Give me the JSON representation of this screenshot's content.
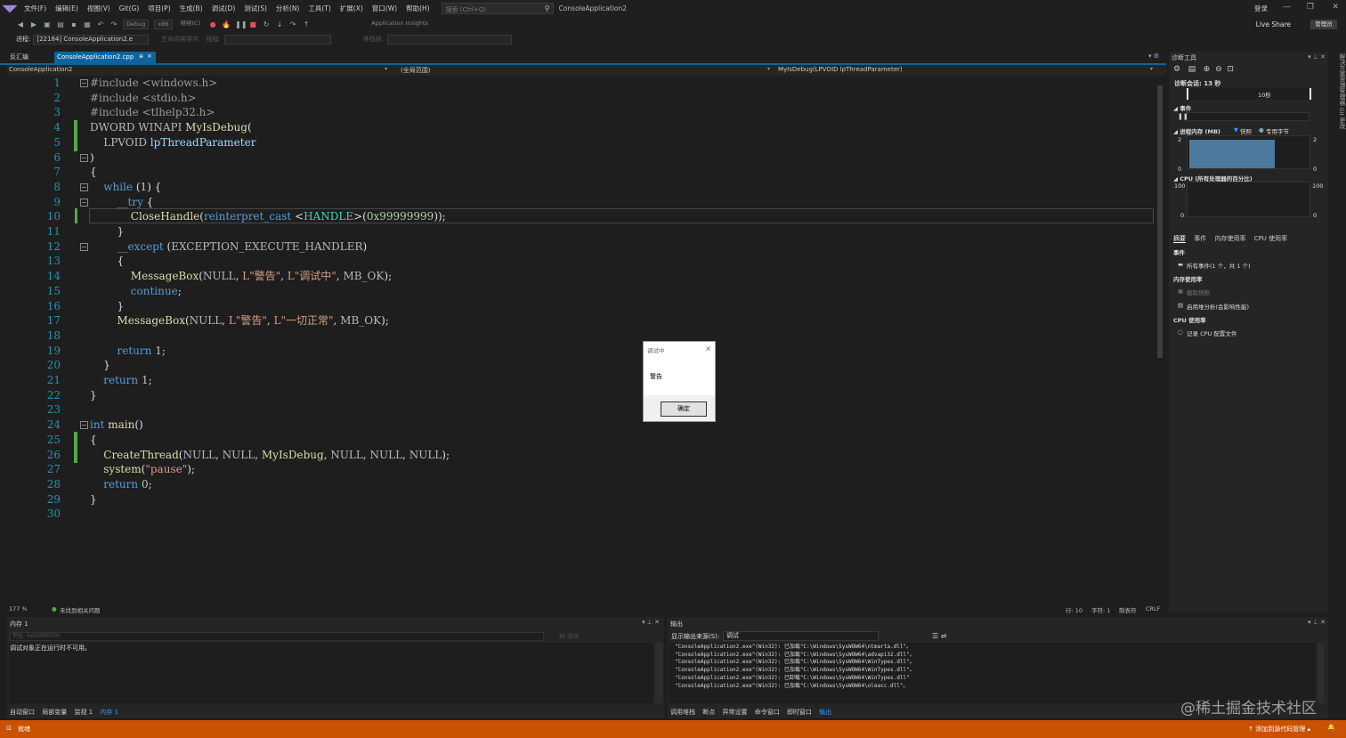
{
  "menu": [
    "文件(F)",
    "编辑(E)",
    "视图(V)",
    "Git(G)",
    "项目(P)",
    "生成(B)",
    "调试(D)",
    "测试(S)",
    "分析(N)",
    "工具(T)",
    "扩展(X)",
    "窗口(W)",
    "帮助(H)"
  ],
  "search": {
    "placeholder": "搜索 (Ctrl+Q)"
  },
  "app_title": "ConsoleApplication2",
  "login": "登录",
  "toolbar": {
    "config": "Debug",
    "platform": "x86",
    "continue": "继续(C)",
    "app_insights": "Application Insights",
    "live_share": "Live Share",
    "admin": "管理员"
  },
  "process": {
    "label": "进程:",
    "value": "[22184] ConsoleApplication2.e",
    "lifecycle": "生命周期事件",
    "thread": "线程:",
    "stack": "堆栈帧:"
  },
  "tabs": {
    "disasm": "反汇编",
    "active": "ConsoleApplication2.cpp",
    "pin": "⊕",
    "close": "×"
  },
  "navbar": {
    "project": "ConsoleApplication2",
    "scope": "(全局范围)",
    "func": "MyIsDebug(LPVOID lpThreadParameter)"
  },
  "code": [
    {
      "n": "1",
      "t": "#include <windows.h>"
    },
    {
      "n": "2",
      "t": "#include <stdio.h>"
    },
    {
      "n": "3",
      "t": "#include <tlhelp32.h>"
    },
    {
      "n": "4",
      "t": "DWORD WINAPI MyIsDebug("
    },
    {
      "n": "5",
      "t": "    LPVOID lpThreadParameter"
    },
    {
      "n": "6",
      "t": ")"
    },
    {
      "n": "7",
      "t": "{"
    },
    {
      "n": "8",
      "t": "    while (1) {"
    },
    {
      "n": "9",
      "t": "        __try {"
    },
    {
      "n": "10",
      "t": "            CloseHandle(reinterpret_cast <HANDLE>(0x99999999));"
    },
    {
      "n": "11",
      "t": "        }"
    },
    {
      "n": "12",
      "t": "        __except (EXCEPTION_EXECUTE_HANDLER)"
    },
    {
      "n": "13",
      "t": "        {"
    },
    {
      "n": "14",
      "t": "            MessageBox(NULL, L\"警告\", L\"调试中\", MB_OK);"
    },
    {
      "n": "15",
      "t": "            continue;"
    },
    {
      "n": "16",
      "t": "        }"
    },
    {
      "n": "17",
      "t": "        MessageBox(NULL, L\"警告\", L\"一切正常\", MB_OK);"
    },
    {
      "n": "18",
      "t": ""
    },
    {
      "n": "19",
      "t": "        return 1;"
    },
    {
      "n": "20",
      "t": "    }"
    },
    {
      "n": "21",
      "t": "    return 1;"
    },
    {
      "n": "22",
      "t": "}"
    },
    {
      "n": "23",
      "t": ""
    },
    {
      "n": "24",
      "t": "int main()"
    },
    {
      "n": "25",
      "t": "{"
    },
    {
      "n": "26",
      "t": "    CreateThread(NULL, NULL, MyIsDebug, NULL, NULL, NULL);"
    },
    {
      "n": "27",
      "t": "    system(\"pause\");"
    },
    {
      "n": "28",
      "t": "    return 0;"
    },
    {
      "n": "29",
      "t": "}"
    },
    {
      "n": "30",
      "t": ""
    }
  ],
  "editor_status": {
    "zoom": "177 %",
    "issues": "未找到相关问题",
    "line": "行: 10",
    "char": "字符: 1",
    "tab": "制表符",
    "eol": "CRLF"
  },
  "dialog": {
    "title": "调试中",
    "message": "警告",
    "ok": "确定",
    "close": "×"
  },
  "diag": {
    "title": "诊断工具",
    "session": "诊断会话: 13 秒",
    "timeline_label": "10秒",
    "events": "事件",
    "memory": "进程内存 (MB)",
    "snapshot": "快照",
    "private_bytes": "专用字节",
    "mem_axis": {
      "top": "2",
      "bottom": "0"
    },
    "cpu": "CPU (所有处理器的百分比)",
    "cpu_axis": {
      "top": "100",
      "bottom": "0"
    },
    "tabs": [
      "摘要",
      "事件",
      "内存使用率",
      "CPU 使用率"
    ],
    "ev_head": "事件",
    "all_events": "所有事件(1 个，共 1 个)",
    "mem_head": "内存使用率",
    "take_snapshot": "截取快照",
    "heap_analysis": "启用堆分析(会影响性能)",
    "cpu_head": "CPU 使用率",
    "record_cpu": "记录 CPU 配置文件"
  },
  "right_strip": "解决方案资源管理器  Git 更改",
  "mem_panel": {
    "title": "内存 1",
    "addr_placeholder": "地址: 0x00000000",
    "cols": "列: 自动",
    "content": "调试对象正在运行时不可用。",
    "tabs": [
      "自动窗口",
      "局部变量",
      "监视 1",
      "内存 1"
    ]
  },
  "out_panel": {
    "title": "输出",
    "src_label": "显示输出来源(S):",
    "src_value": "调试",
    "lines": [
      "\"ConsoleApplication2.exe\"(Win32): 已加载\"C:\\Windows\\SysWOW64\\ntmarta.dll\"。",
      "\"ConsoleApplication2.exe\"(Win32): 已加载\"C:\\Windows\\SysWOW64\\advapi32.dll\"。",
      "\"ConsoleApplication2.exe\"(Win32): 已加载\"C:\\Windows\\SysWOW64\\WinTypes.dll\"。",
      "\"ConsoleApplication2.exe\"(Win32): 已加载\"C:\\Windows\\SysWOW64\\WinTypes.dll\"。",
      "\"ConsoleApplication2.exe\"(Win32): 已卸载\"C:\\Windows\\SysWOW64\\WinTypes.dll\"",
      "\"ConsoleApplication2.exe\"(Win32): 已加载\"C:\\Windows\\SysWOW64\\oleacc.dll\"。"
    ],
    "tabs": [
      "调用堆栈",
      "断点",
      "异常设置",
      "命令窗口",
      "即时窗口",
      "输出"
    ]
  },
  "status": {
    "ready": "就绪",
    "source_control": "添加到源代码管理"
  },
  "watermark": "@稀土掘金技术社区",
  "colors": {
    "accent": "#0e639c",
    "statusbar": "#ca5100",
    "line_number": "#2b91af"
  }
}
